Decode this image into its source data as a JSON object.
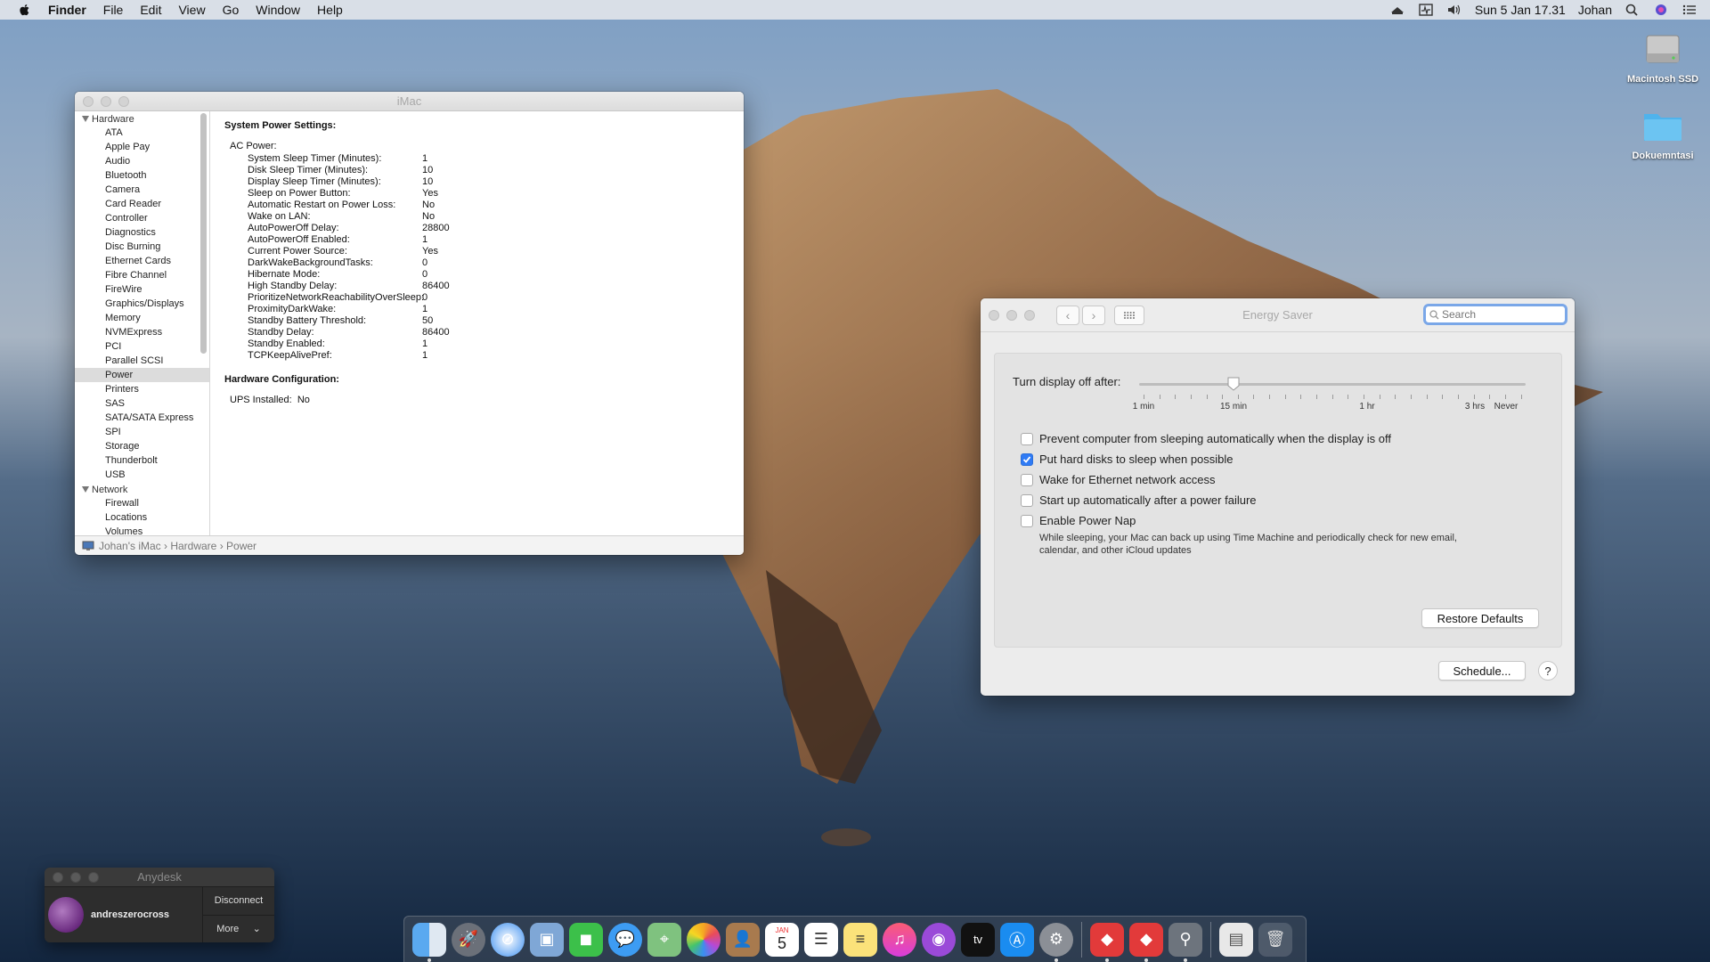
{
  "menubar": {
    "app": "Finder",
    "items": [
      "File",
      "Edit",
      "View",
      "Go",
      "Window",
      "Help"
    ],
    "clock": "Sun 5 Jan  17.31",
    "user": "Johan"
  },
  "desktop": {
    "icons": [
      {
        "label": "Macintosh SSD",
        "icon": "hard-drive-icon"
      },
      {
        "label": "Dokuemntasi",
        "icon": "folder-icon"
      }
    ]
  },
  "sysinfo": {
    "title": "iMac",
    "sidebar": {
      "groups": [
        {
          "label": "Hardware",
          "items": [
            "ATA",
            "Apple Pay",
            "Audio",
            "Bluetooth",
            "Camera",
            "Card Reader",
            "Controller",
            "Diagnostics",
            "Disc Burning",
            "Ethernet Cards",
            "Fibre Channel",
            "FireWire",
            "Graphics/Displays",
            "Memory",
            "NVMExpress",
            "PCI",
            "Parallel SCSI",
            "Power",
            "Printers",
            "SAS",
            "SATA/SATA Express",
            "SPI",
            "Storage",
            "Thunderbolt",
            "USB"
          ]
        },
        {
          "label": "Network",
          "items": [
            "Firewall",
            "Locations",
            "Volumes"
          ]
        }
      ],
      "selected": "Power"
    },
    "content": {
      "heading1": "System Power Settings:",
      "ac_label": "AC Power:",
      "rows": [
        {
          "k": "System Sleep Timer (Minutes):",
          "v": "1"
        },
        {
          "k": "Disk Sleep Timer (Minutes):",
          "v": "10"
        },
        {
          "k": "Display Sleep Timer (Minutes):",
          "v": "10"
        },
        {
          "k": "Sleep on Power Button:",
          "v": "Yes"
        },
        {
          "k": "Automatic Restart on Power Loss:",
          "v": "No"
        },
        {
          "k": "Wake on LAN:",
          "v": "No"
        },
        {
          "k": "AutoPowerOff Delay:",
          "v": "28800"
        },
        {
          "k": "AutoPowerOff Enabled:",
          "v": "1"
        },
        {
          "k": "Current Power Source:",
          "v": "Yes"
        },
        {
          "k": "DarkWakeBackgroundTasks:",
          "v": "0"
        },
        {
          "k": "Hibernate Mode:",
          "v": "0"
        },
        {
          "k": "High Standby Delay:",
          "v": "86400"
        },
        {
          "k": "PrioritizeNetworkReachabilityOverSleep:",
          "v": "0"
        },
        {
          "k": "ProximityDarkWake:",
          "v": "1"
        },
        {
          "k": "Standby Battery Threshold:",
          "v": "50"
        },
        {
          "k": "Standby Delay:",
          "v": "86400"
        },
        {
          "k": "Standby Enabled:",
          "v": "1"
        },
        {
          "k": "TCPKeepAlivePref:",
          "v": "1"
        }
      ],
      "heading2": "Hardware Configuration:",
      "ups_label": "UPS Installed:",
      "ups_value": "No"
    },
    "path": [
      "Johan's iMac",
      "Hardware",
      "Power"
    ]
  },
  "energy": {
    "title": "Energy Saver",
    "search_placeholder": "Search",
    "slider_label": "Turn display off after:",
    "slider_value_label": "15 min",
    "tick_labels": [
      "1 min",
      "15 min",
      "1 hr",
      "3 hrs",
      "Never"
    ],
    "checkboxes": [
      {
        "label": "Prevent computer from sleeping automatically when the display is off",
        "checked": false
      },
      {
        "label": "Put hard disks to sleep when possible",
        "checked": true
      },
      {
        "label": "Wake for Ethernet network access",
        "checked": false
      },
      {
        "label": "Start up automatically after a power failure",
        "checked": false
      },
      {
        "label": "Enable Power Nap",
        "checked": false
      }
    ],
    "power_nap_note": "While sleeping, your Mac can back up using Time Machine and periodically check for new email, calendar, and other iCloud updates",
    "restore_label": "Restore Defaults",
    "schedule_label": "Schedule...",
    "help_label": "?"
  },
  "anydesk": {
    "title": "Anydesk",
    "user": "andreszerocross",
    "disconnect": "Disconnect",
    "more": "More"
  },
  "dock": {
    "calendar_day": "5",
    "calendar_month": "JAN",
    "tv_label": "tv"
  }
}
